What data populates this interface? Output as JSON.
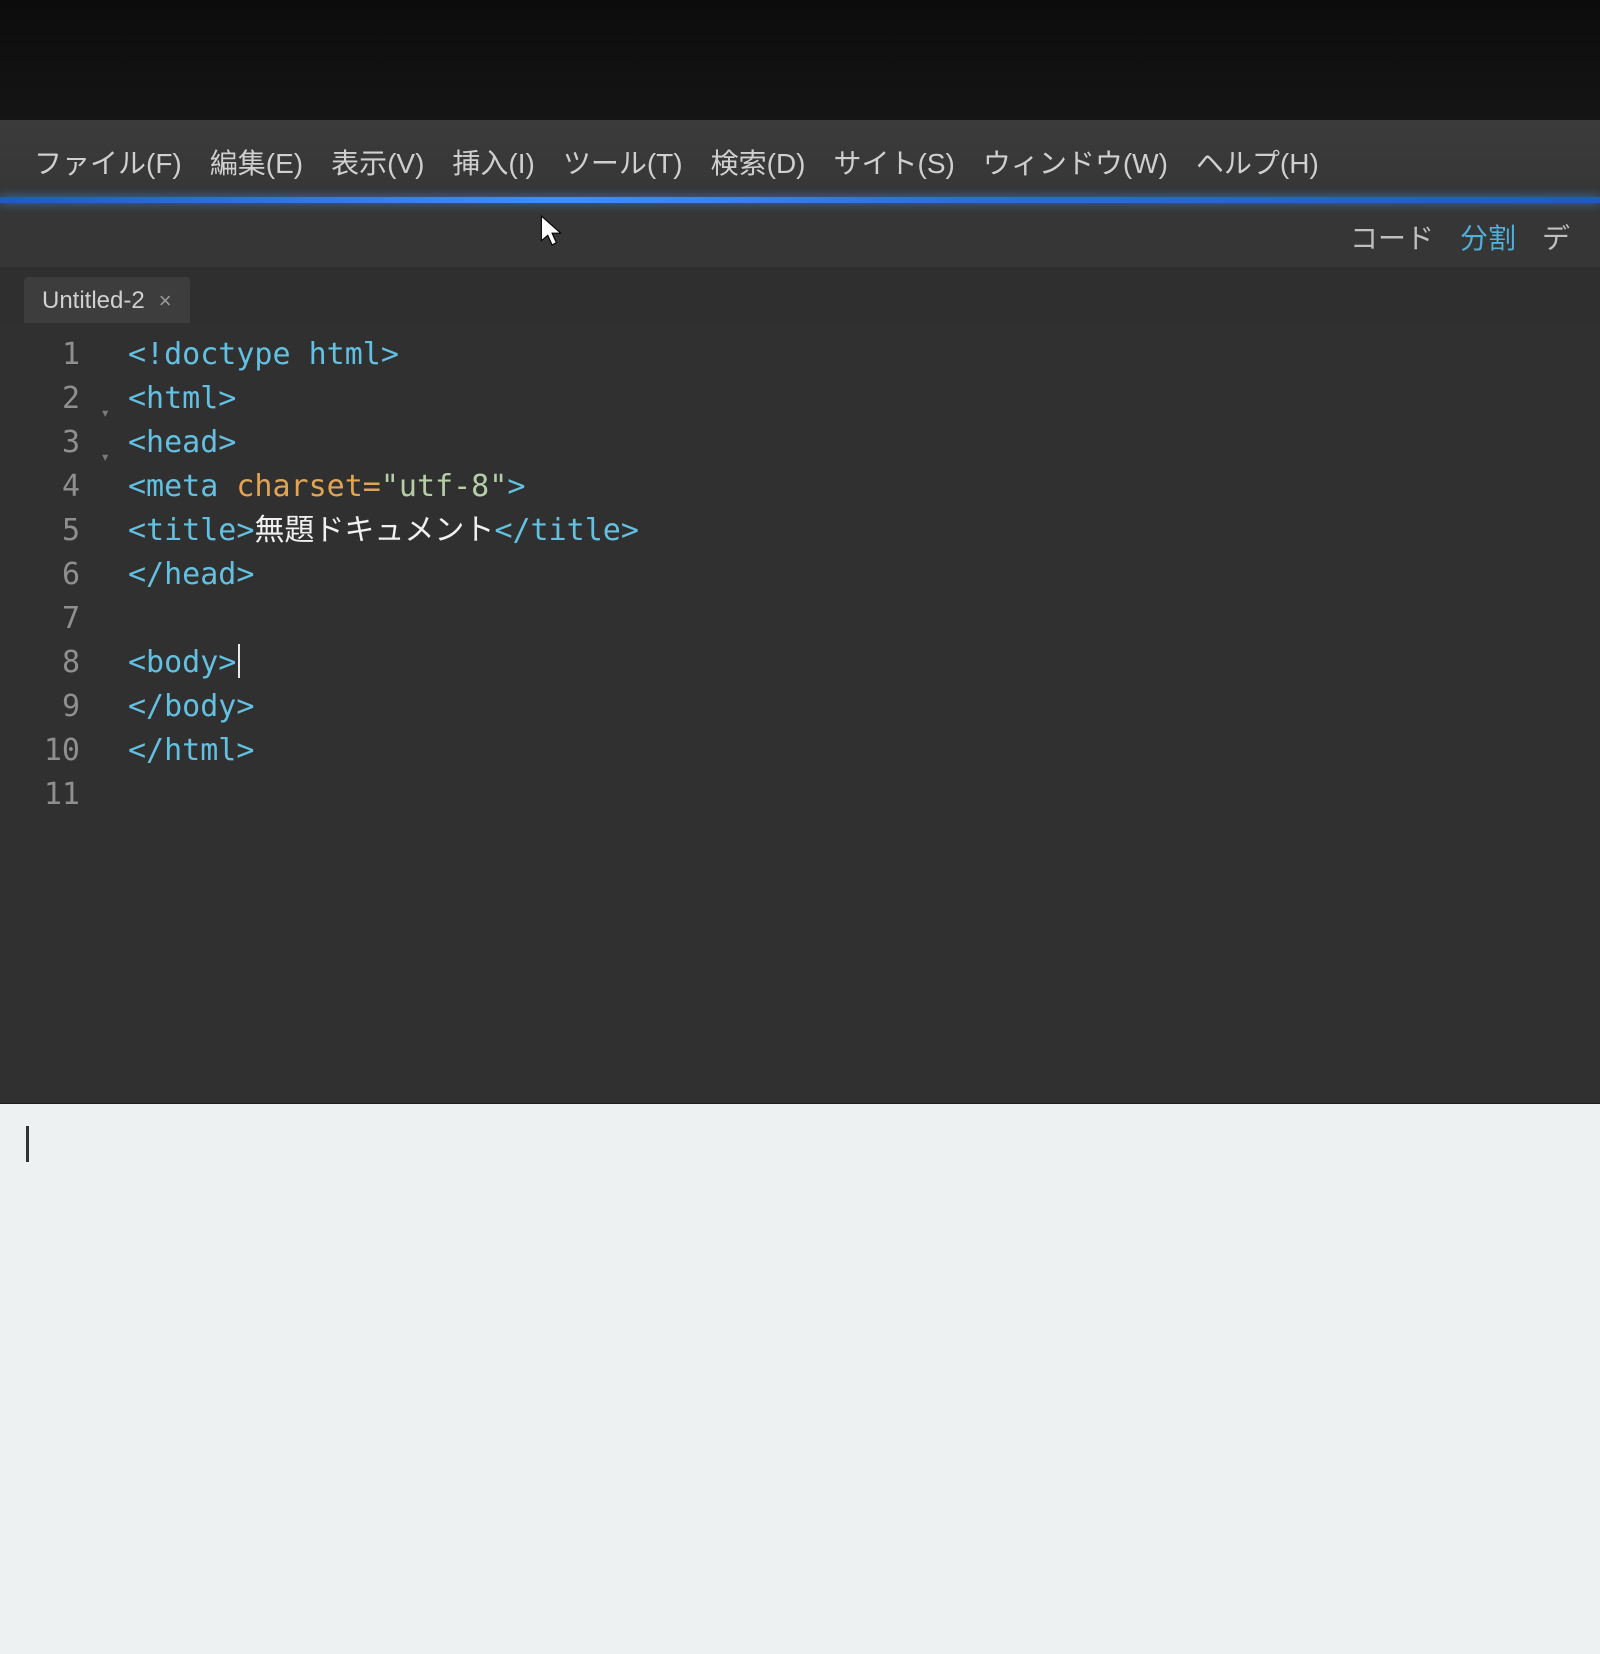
{
  "menu": {
    "items": [
      "ファイル(F)",
      "編集(E)",
      "表示(V)",
      "挿入(I)",
      "ツール(T)",
      "検索(D)",
      "サイト(S)",
      "ウィンドウ(W)",
      "ヘルプ(H)"
    ]
  },
  "viewbar": {
    "code": "コード",
    "split": "分割",
    "design_partial": "デ"
  },
  "tab": {
    "title": "Untitled-2",
    "close": "×"
  },
  "editor": {
    "lines": [
      {
        "n": "1",
        "fold": "",
        "html": "<span class='tag'>&lt;!doctype html&gt;</span>"
      },
      {
        "n": "2",
        "fold": "▾",
        "html": "<span class='tag'>&lt;html&gt;</span>"
      },
      {
        "n": "3",
        "fold": "▾",
        "html": "<span class='tag'>&lt;head&gt;</span>"
      },
      {
        "n": "4",
        "fold": "",
        "html": "<span class='tag'>&lt;meta</span> <span class='attr'>charset=</span><span class='str'>\"utf-8\"</span><span class='tag'>&gt;</span>"
      },
      {
        "n": "5",
        "fold": "",
        "html": "<span class='tag'>&lt;title&gt;</span><span class='text'>無題ドキュメント</span><span class='tag'>&lt;/title&gt;</span>"
      },
      {
        "n": "6",
        "fold": "",
        "html": "<span class='tag'>&lt;/head&gt;</span>"
      },
      {
        "n": "7",
        "fold": "",
        "html": ""
      },
      {
        "n": "8",
        "fold": "",
        "html": "<span class='tag'>&lt;body&gt;</span><span class='caret'></span>"
      },
      {
        "n": "9",
        "fold": "",
        "html": "<span class='tag'>&lt;/body&gt;</span>"
      },
      {
        "n": "10",
        "fold": "",
        "html": "<span class='tag'>&lt;/html&gt;</span>"
      },
      {
        "n": "11",
        "fold": "",
        "html": ""
      }
    ]
  }
}
